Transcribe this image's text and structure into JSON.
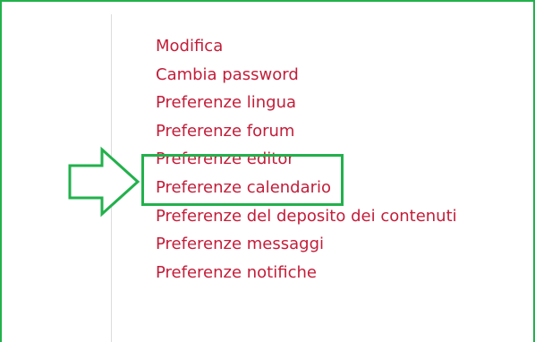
{
  "menu": {
    "items": [
      {
        "label": "Modifica"
      },
      {
        "label": "Cambia password"
      },
      {
        "label": "Preferenze lingua"
      },
      {
        "label": "Preferenze forum"
      },
      {
        "label": "Preferenze editor",
        "highlighted": true
      },
      {
        "label": "Preferenze calendario"
      },
      {
        "label": "Preferenze del deposito dei contenuti"
      },
      {
        "label": "Preferenze messaggi"
      },
      {
        "label": "Preferenze notifiche"
      }
    ]
  },
  "colors": {
    "link": "#c31d39",
    "highlight": "#22b14c",
    "divider": "#dcdcdc"
  },
  "icons": {
    "pointer": "arrow-right-icon"
  }
}
